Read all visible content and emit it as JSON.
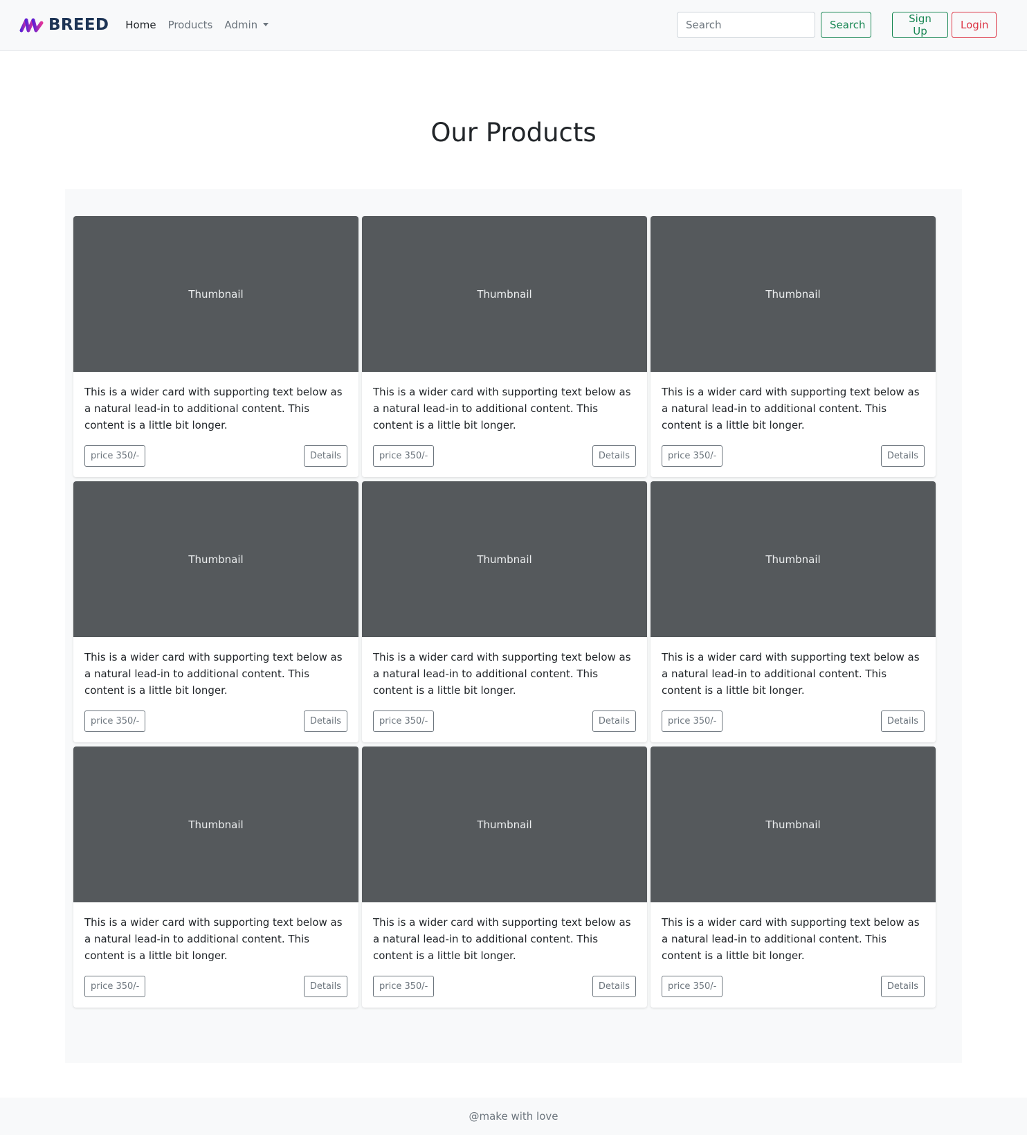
{
  "brand": {
    "name": "BREED",
    "logo_icon": "breed-logo-icon"
  },
  "nav": {
    "items": [
      {
        "label": "Home",
        "active": true
      },
      {
        "label": "Products",
        "active": false
      }
    ],
    "dropdown": {
      "label": "Admin"
    }
  },
  "search": {
    "placeholder": "Search",
    "value": "",
    "button_label": "Search"
  },
  "auth": {
    "signup_label": "Sign Up",
    "login_label": "Login"
  },
  "page": {
    "title": "Our Products"
  },
  "products": [
    {
      "thumbnail_label": "Thumbnail",
      "description": "This is a wider card with supporting text below as a natural lead-in to additional content. This content is a little bit longer.",
      "price_label": "price 350/-",
      "details_label": "Details"
    },
    {
      "thumbnail_label": "Thumbnail",
      "description": "This is a wider card with supporting text below as a natural lead-in to additional content. This content is a little bit longer.",
      "price_label": "price 350/-",
      "details_label": "Details"
    },
    {
      "thumbnail_label": "Thumbnail",
      "description": "This is a wider card with supporting text below as a natural lead-in to additional content. This content is a little bit longer.",
      "price_label": "price 350/-",
      "details_label": "Details"
    },
    {
      "thumbnail_label": "Thumbnail",
      "description": "This is a wider card with supporting text below as a natural lead-in to additional content. This content is a little bit longer.",
      "price_label": "price 350/-",
      "details_label": "Details"
    },
    {
      "thumbnail_label": "Thumbnail",
      "description": "This is a wider card with supporting text below as a natural lead-in to additional content. This content is a little bit longer.",
      "price_label": "price 350/-",
      "details_label": "Details"
    },
    {
      "thumbnail_label": "Thumbnail",
      "description": "This is a wider card with supporting text below as a natural lead-in to additional content. This content is a little bit longer.",
      "price_label": "price 350/-",
      "details_label": "Details"
    },
    {
      "thumbnail_label": "Thumbnail",
      "description": "This is a wider card with supporting text below as a natural lead-in to additional content. This content is a little bit longer.",
      "price_label": "price 350/-",
      "details_label": "Details"
    },
    {
      "thumbnail_label": "Thumbnail",
      "description": "This is a wider card with supporting text below as a natural lead-in to additional content. This content is a little bit longer.",
      "price_label": "price 350/-",
      "details_label": "Details"
    },
    {
      "thumbnail_label": "Thumbnail",
      "description": "This is a wider card with supporting text below as a natural lead-in to additional content. This content is a little bit longer.",
      "price_label": "price 350/-",
      "details_label": "Details"
    }
  ],
  "footer": {
    "text": "@make with love"
  },
  "colors": {
    "navbar_bg": "#f8f9fa",
    "success": "#198754",
    "danger": "#dc3545",
    "thumbnail_bg": "#55595c",
    "muted": "#6c757d"
  }
}
